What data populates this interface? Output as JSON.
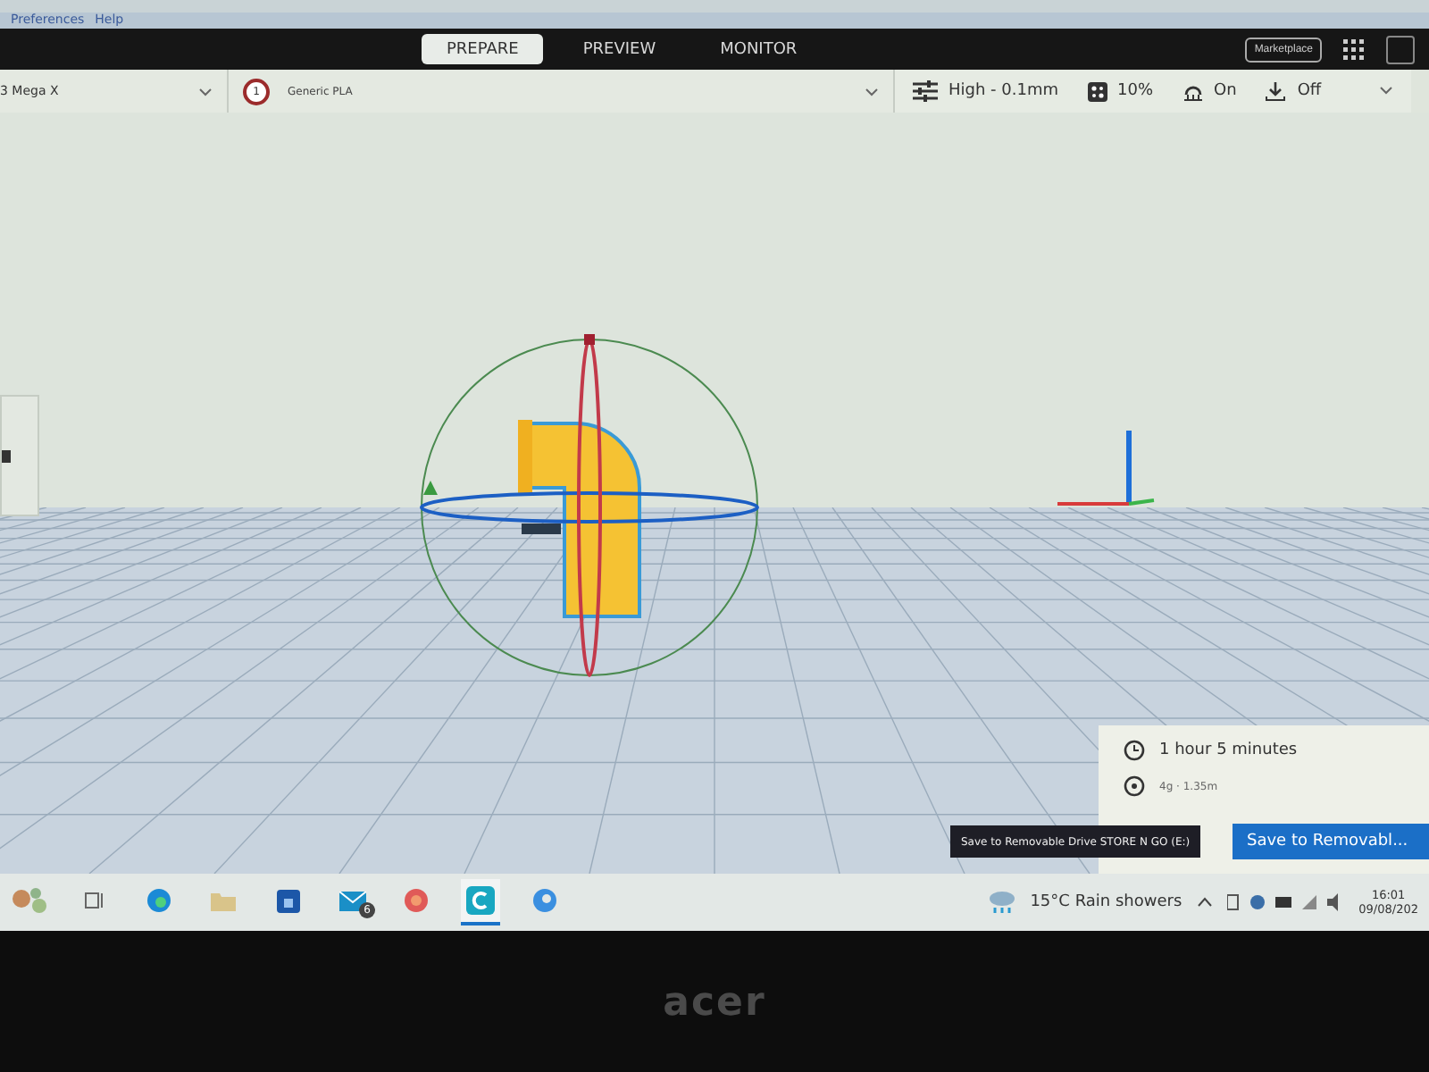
{
  "menu": [
    "Preferences",
    "Help"
  ],
  "tabs": [
    {
      "label": "PREPARE",
      "selected": true
    },
    {
      "label": "PREVIEW",
      "selected": false
    },
    {
      "label": "MONITOR",
      "selected": false
    }
  ],
  "marketplace": "Marketplace",
  "printer": "3 Mega X",
  "material": {
    "index": "1",
    "name": "Generic PLA"
  },
  "print_settings": [
    {
      "kind": "profile",
      "label": "High - 0.1mm"
    },
    {
      "kind": "infill",
      "label": "10%"
    },
    {
      "kind": "support",
      "label": "On"
    },
    {
      "kind": "adhesion",
      "label": "Off"
    }
  ],
  "print_summary": {
    "time": "1 hour 5 minutes",
    "material": "4g · 1.35m",
    "button": "Save to Removabl...",
    "tooltip": "Save to Removable Drive STORE N GO (E:)"
  },
  "taskbar": {
    "apps": [
      {
        "kind": "widgets",
        "active": false
      },
      {
        "kind": "taskview",
        "active": false
      },
      {
        "kind": "browser",
        "active": false
      },
      {
        "kind": "folder",
        "active": false
      },
      {
        "kind": "store",
        "active": false
      },
      {
        "kind": "mail",
        "active": false,
        "badge": "6"
      },
      {
        "kind": "firefox",
        "active": false
      },
      {
        "kind": "cura",
        "active": true
      },
      {
        "kind": "edge",
        "active": false
      }
    ],
    "weather": {
      "temp": "15°C",
      "condition": "Rain showers"
    },
    "clock": {
      "time": "16:01",
      "date": "09/08/202"
    }
  },
  "bezel_logo": "acer"
}
